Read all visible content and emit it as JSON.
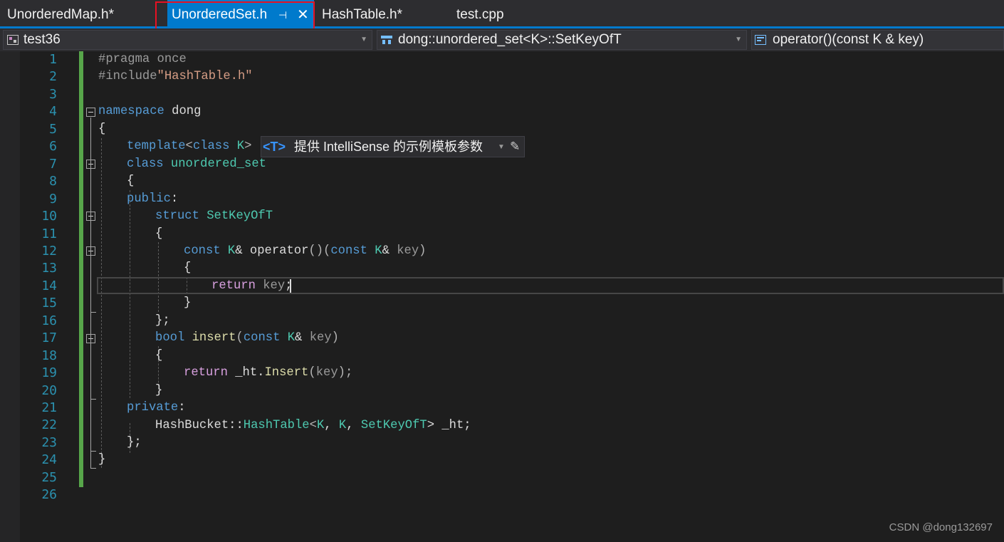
{
  "tabs": [
    {
      "label": "UnorderedMap.h*",
      "active": false
    },
    {
      "label": "UnorderedSet.h",
      "active": true
    },
    {
      "label": "HashTable.h*",
      "active": false
    },
    {
      "label": "test.cpp",
      "active": false
    }
  ],
  "tab_icons": {
    "pin": "pin-icon",
    "close": "close-icon"
  },
  "nav": {
    "project": "test36",
    "scope": "dong::unordered_set<K>::SetKeyOfT",
    "member": "operator()(const K & key)"
  },
  "template_bar": {
    "icon": "<T>",
    "text": "提供 IntelliSense 的示例模板参数"
  },
  "editor": {
    "line_numbers": [
      "1",
      "2",
      "3",
      "4",
      "5",
      "6",
      "7",
      "8",
      "9",
      "10",
      "11",
      "12",
      "13",
      "14",
      "15",
      "16",
      "17",
      "18",
      "19",
      "20",
      "21",
      "22",
      "23",
      "24",
      "25",
      "26"
    ],
    "current_line": 14,
    "code": {
      "l1": "#pragma once",
      "l2_a": "#include",
      "l2_b": "\"HashTable.h\"",
      "l4_a": "namespace",
      "l4_b": " dong",
      "l5": "{",
      "l6_a": "template",
      "l6_b": "<",
      "l6_c": "class",
      "l6_d": " ",
      "l6_e": "K",
      "l6_f": ">",
      "l7_a": "class",
      "l7_b": " ",
      "l7_c": "unordered_set",
      "l8": "{",
      "l9_a": "public",
      "l9_b": ":",
      "l10_a": "struct",
      "l10_b": " ",
      "l10_c": "SetKeyOfT",
      "l11": "{",
      "l12_a": "const",
      "l12_b": " ",
      "l12_c": "K",
      "l12_d": "& ",
      "l12_e": "operator",
      "l12_f": "()(",
      "l12_g": "const",
      "l12_h": " ",
      "l12_i": "K",
      "l12_j": "& ",
      "l12_k": "key",
      "l12_l": ")",
      "l13": "{",
      "l14_a": "return",
      "l14_b": " ",
      "l14_c": "key",
      "l14_d": ";",
      "l15": "}",
      "l16": "};",
      "l17_a": "bool",
      "l17_b": " ",
      "l17_c": "insert",
      "l17_d": "(",
      "l17_e": "const",
      "l17_f": " ",
      "l17_g": "K",
      "l17_h": "& ",
      "l17_i": "key",
      "l17_j": ")",
      "l18": "{",
      "l19_a": "return",
      "l19_b": " _ht.",
      "l19_c": "Insert",
      "l19_d": "(",
      "l19_e": "key",
      "l19_f": ");",
      "l20": "}",
      "l21_a": "private",
      "l21_b": ":",
      "l22_a": "HashBucket::",
      "l22_b": "HashTable",
      "l22_c": "<",
      "l22_d": "K",
      "l22_e": ", ",
      "l22_f": "K",
      "l22_g": ", ",
      "l22_h": "SetKeyOfT",
      "l22_i": "> _ht;",
      "l23": "};",
      "l24": "}"
    }
  },
  "watermark": "CSDN @dong132697",
  "colors": {
    "accent": "#007acc",
    "highlight_box": "#e81123",
    "change_bar": "#57a64a",
    "line_number": "#2b91af",
    "keyword": "#569cd6",
    "type": "#4ec9b0",
    "function": "#dcdcaa",
    "string": "#d69d85",
    "control_keyword": "#d8a0df"
  }
}
